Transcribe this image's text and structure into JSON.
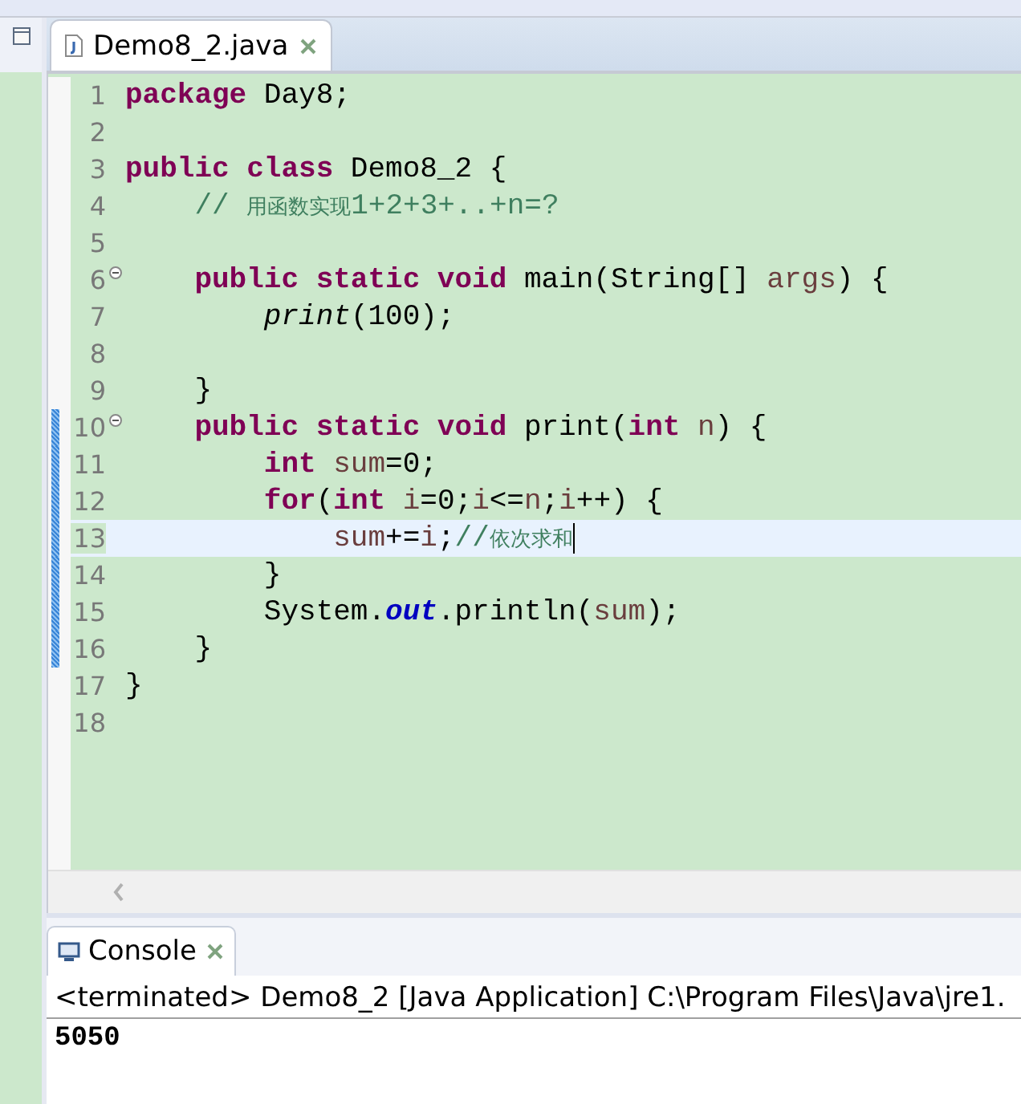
{
  "editor": {
    "tab": {
      "title": "Demo8_2.java",
      "selected": true
    },
    "lines": [
      {
        "number": "1",
        "fold": false,
        "marked": false,
        "current": false,
        "tokens": [
          {
            "kind": "kw",
            "text": "package"
          },
          {
            "kind": "text",
            "text": " Day8;"
          }
        ]
      },
      {
        "number": "2",
        "fold": false,
        "marked": false,
        "current": false
      },
      {
        "number": "3",
        "fold": false,
        "marked": false,
        "current": false,
        "tokens": [
          {
            "kind": "kw",
            "text": "public class"
          },
          {
            "kind": "text",
            "text": " Demo8_2 {"
          }
        ]
      },
      {
        "number": "4",
        "fold": false,
        "marked": false,
        "current": false,
        "tokens": [
          {
            "kind": "comment",
            "text": "    // "
          },
          {
            "kind": "cjk",
            "text": "用函数实现"
          },
          {
            "kind": "comment",
            "text": "1+2+3+..+n=?"
          }
        ]
      },
      {
        "number": "5",
        "fold": false,
        "marked": false,
        "current": false
      },
      {
        "number": "6",
        "fold": true,
        "marked": false,
        "current": false,
        "tokens": [
          {
            "kind": "kw",
            "text": "    public static void"
          },
          {
            "kind": "text",
            "text": " main(String[] "
          },
          {
            "kind": "local",
            "text": "args"
          },
          {
            "kind": "text",
            "text": ") {"
          }
        ]
      },
      {
        "number": "7",
        "fold": false,
        "marked": false,
        "current": false,
        "tokens": [
          {
            "kind": "call",
            "text": "        print"
          },
          {
            "kind": "text",
            "text": "(100);"
          }
        ]
      },
      {
        "number": "8",
        "fold": false,
        "marked": false,
        "current": false
      },
      {
        "number": "9",
        "fold": false,
        "marked": false,
        "current": false,
        "tokens": [
          {
            "kind": "text",
            "text": "    }"
          }
        ]
      },
      {
        "number": "10",
        "fold": true,
        "marked": true,
        "current": false,
        "tokens": [
          {
            "kind": "kw",
            "text": "    public static void"
          },
          {
            "kind": "text",
            "text": " print("
          },
          {
            "kind": "kw",
            "text": "int"
          },
          {
            "kind": "local",
            "text": " n"
          },
          {
            "kind": "text",
            "text": ") {"
          }
        ]
      },
      {
        "number": "11",
        "fold": false,
        "marked": true,
        "current": false,
        "tokens": [
          {
            "kind": "kw",
            "text": "        int"
          },
          {
            "kind": "local",
            "text": " sum"
          },
          {
            "kind": "text",
            "text": "=0;"
          }
        ]
      },
      {
        "number": "12",
        "fold": false,
        "marked": true,
        "current": false,
        "tokens": [
          {
            "kind": "kw",
            "text": "        for"
          },
          {
            "kind": "text",
            "text": "("
          },
          {
            "kind": "kw",
            "text": "int"
          },
          {
            "kind": "local",
            "text": " i"
          },
          {
            "kind": "text",
            "text": "=0;"
          },
          {
            "kind": "local",
            "text": "i"
          },
          {
            "kind": "text",
            "text": "<="
          },
          {
            "kind": "local",
            "text": "n"
          },
          {
            "kind": "text",
            "text": ";"
          },
          {
            "kind": "local",
            "text": "i"
          },
          {
            "kind": "text",
            "text": "++) {"
          }
        ]
      },
      {
        "number": "13",
        "fold": false,
        "marked": true,
        "current": true,
        "tokens": [
          {
            "kind": "local",
            "text": "            sum"
          },
          {
            "kind": "text",
            "text": "+="
          },
          {
            "kind": "local",
            "text": "i"
          },
          {
            "kind": "text",
            "text": ";"
          },
          {
            "kind": "comment",
            "text": "//"
          },
          {
            "kind": "cjk",
            "text": "依次求和"
          }
        ]
      },
      {
        "number": "14",
        "fold": false,
        "marked": true,
        "current": false,
        "tokens": [
          {
            "kind": "text",
            "text": "        }"
          }
        ]
      },
      {
        "number": "15",
        "fold": false,
        "marked": true,
        "current": false,
        "tokens": [
          {
            "kind": "text",
            "text": "        System."
          },
          {
            "kind": "field",
            "text": "out"
          },
          {
            "kind": "text",
            "text": ".println("
          },
          {
            "kind": "local",
            "text": "sum"
          },
          {
            "kind": "text",
            "text": ");"
          }
        ]
      },
      {
        "number": "16",
        "fold": false,
        "marked": true,
        "current": false,
        "tokens": [
          {
            "kind": "text",
            "text": "    }"
          }
        ]
      },
      {
        "number": "17",
        "fold": false,
        "marked": false,
        "current": false,
        "tokens": [
          {
            "kind": "text",
            "text": "}"
          }
        ]
      },
      {
        "number": "18",
        "fold": false,
        "marked": false,
        "current": false
      }
    ]
  },
  "console": {
    "tab": {
      "title": "Console",
      "selected": true
    },
    "header": "<terminated> Demo8_2 [Java Application] C:\\Program Files\\Java\\jre1.",
    "output": "5050"
  }
}
